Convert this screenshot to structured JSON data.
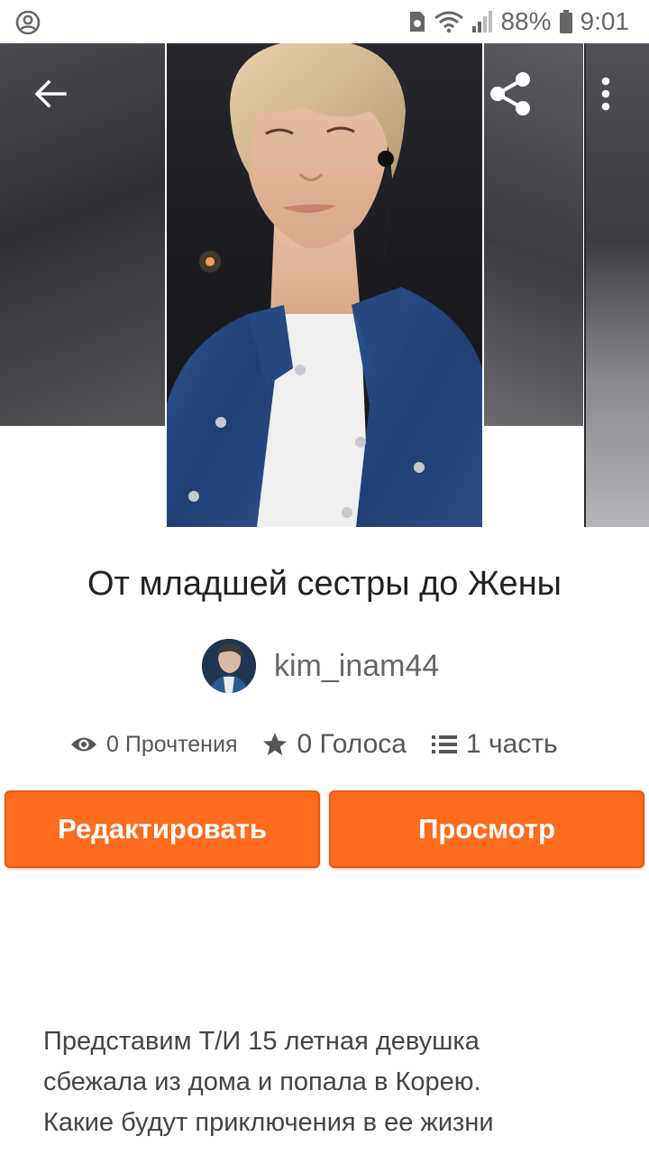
{
  "status_bar": {
    "battery_percent": "88%",
    "time": "9:01",
    "icons": [
      "account-circle-icon",
      "sim-icon",
      "wifi-icon",
      "signal-icon",
      "battery-icon"
    ]
  },
  "header": {
    "icons": [
      "back-arrow-icon",
      "share-icon",
      "more-vert-icon"
    ]
  },
  "story": {
    "title": "От младшей сестры до Жены",
    "author": "kim_inam44",
    "stats": {
      "reads": "0 Прочтения",
      "votes": "0 Голоса",
      "parts": "1 часть"
    },
    "description_lines": [
      "Представим Т/И 15 летная девушка",
      "сбежала из дома и попала в Корею.",
      "Какие будут приключения в ее жизни"
    ]
  },
  "actions": {
    "edit_label": "Редактировать",
    "view_label": "Просмотр"
  },
  "colors": {
    "accent": "#ff6c1e",
    "text": "#222222",
    "muted": "#666666"
  }
}
